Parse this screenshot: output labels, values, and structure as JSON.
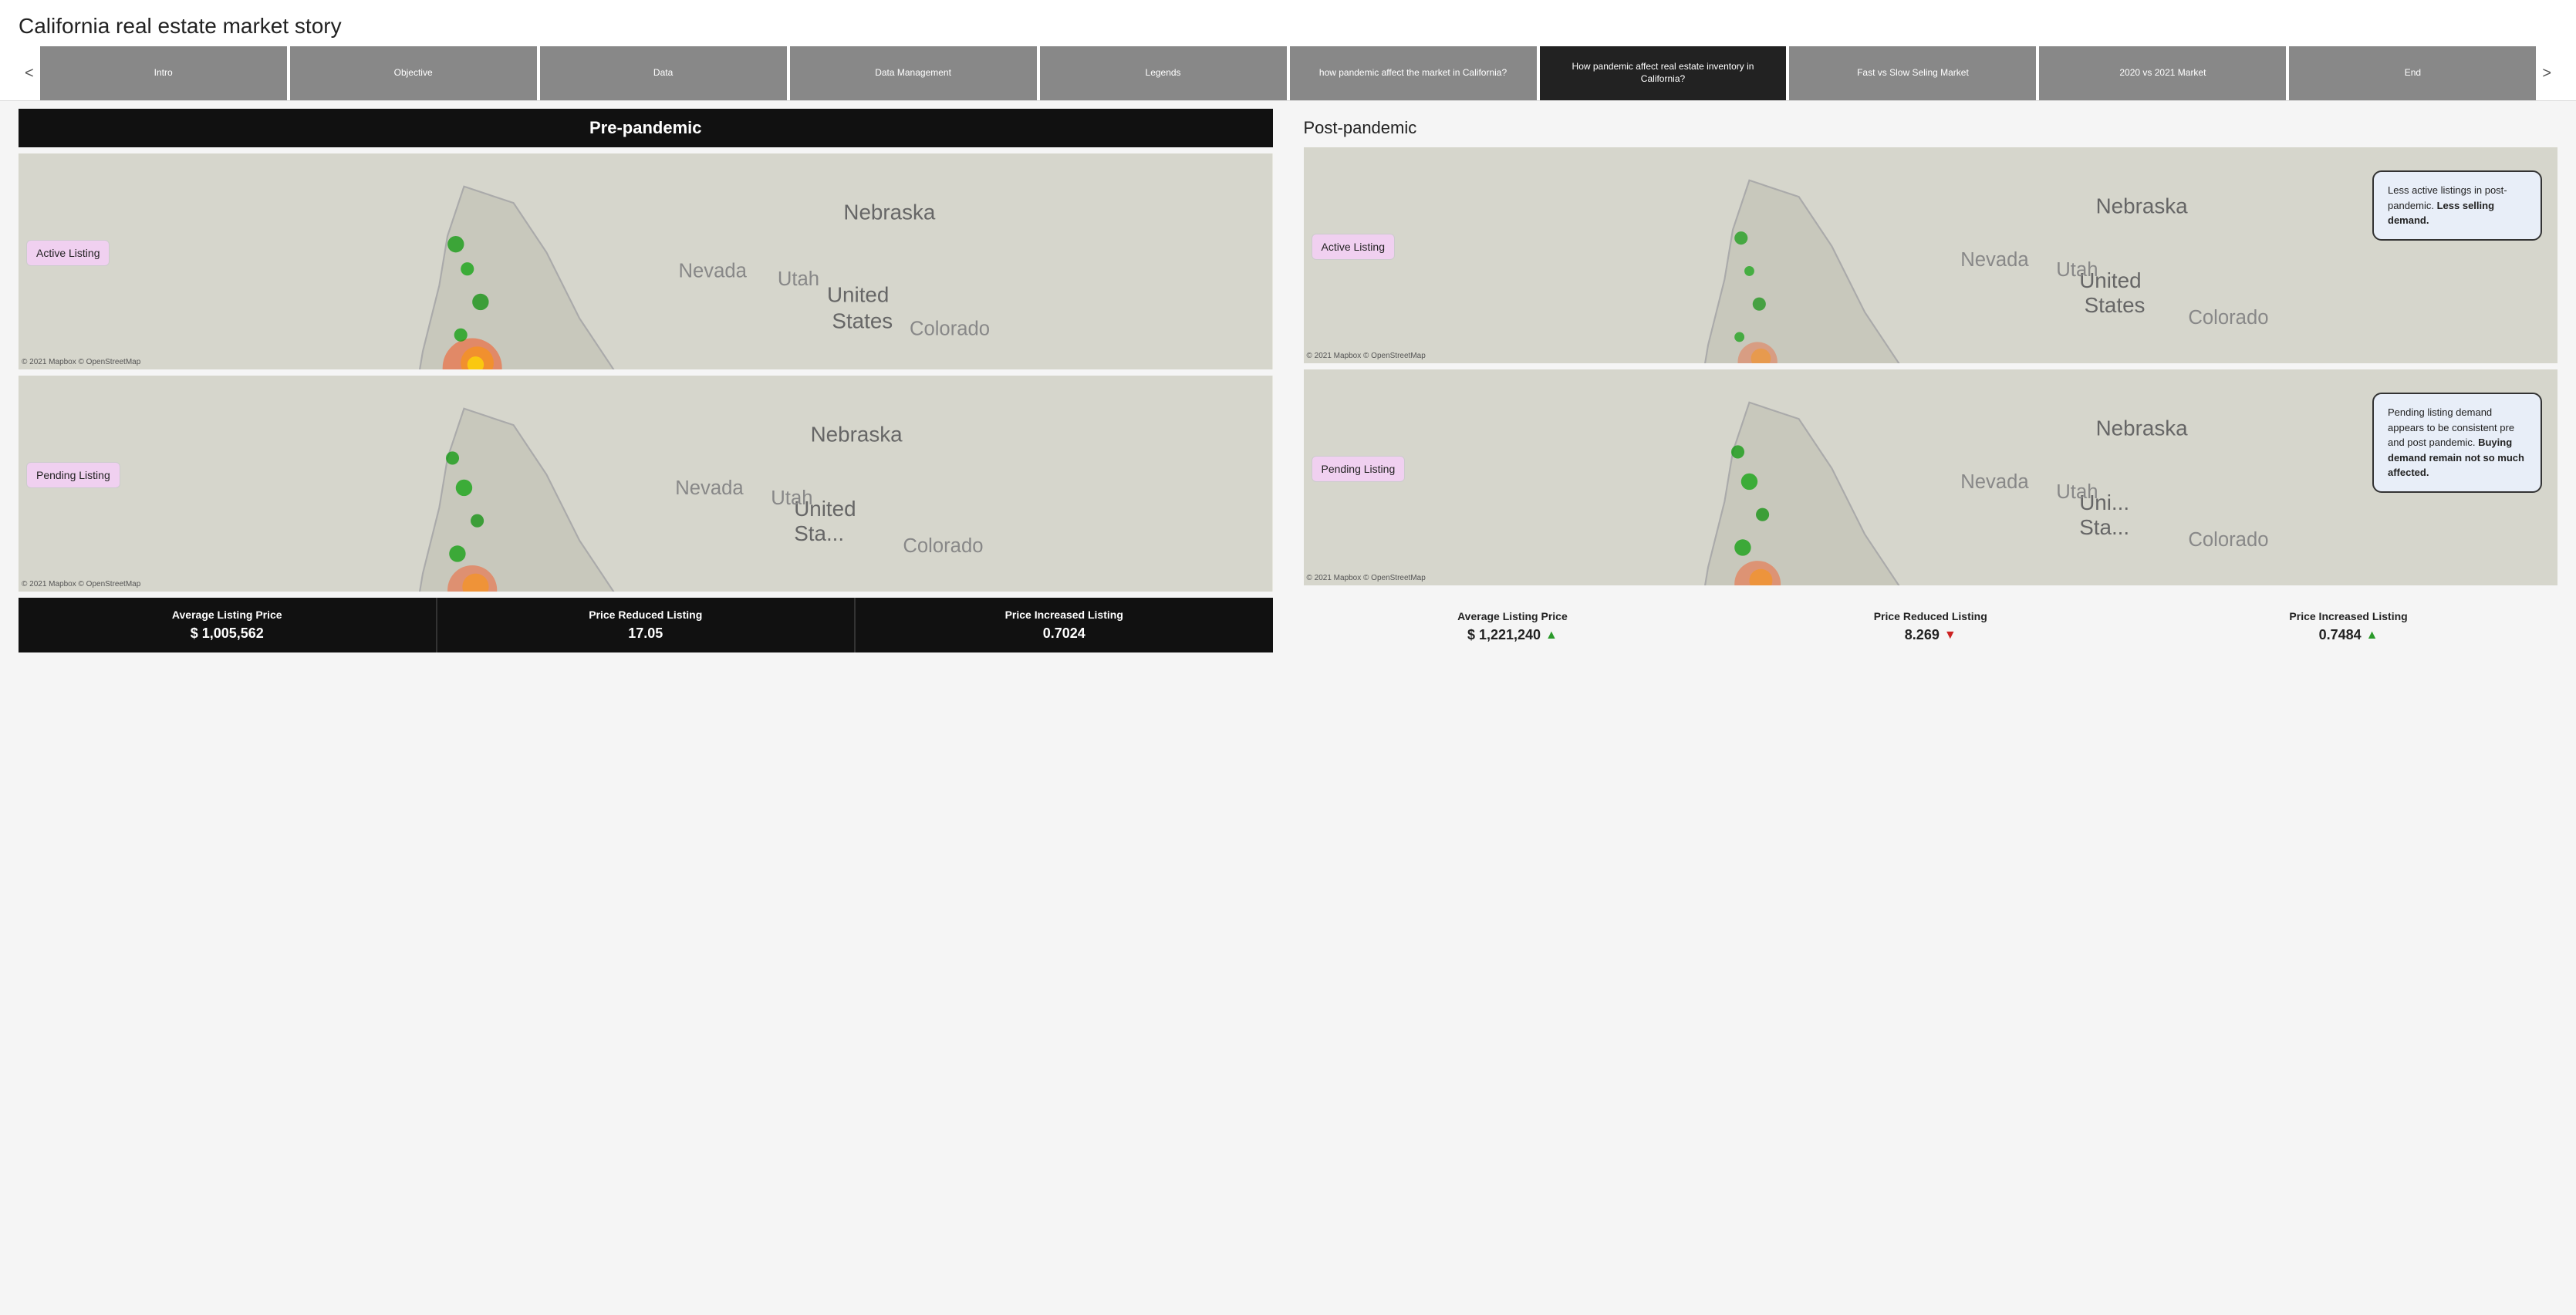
{
  "page": {
    "title": "California real estate market story"
  },
  "nav": {
    "prev_label": "<",
    "next_label": ">",
    "tabs": [
      {
        "id": "intro",
        "label": "Intro",
        "active": false
      },
      {
        "id": "objective",
        "label": "Objective",
        "active": false
      },
      {
        "id": "data",
        "label": "Data",
        "active": false
      },
      {
        "id": "data-management",
        "label": "Data Management",
        "active": false
      },
      {
        "id": "legends",
        "label": "Legends",
        "active": false
      },
      {
        "id": "how-pandemic-affect",
        "label": "how pandemic affect the market in California?",
        "active": false
      },
      {
        "id": "how-pandemic-inventory",
        "label": "How pandemic affect real estate inventory in California?",
        "active": true
      },
      {
        "id": "fast-vs-slow",
        "label": "Fast vs Slow Seling Market",
        "active": false
      },
      {
        "id": "2020-vs-2021",
        "label": "2020 vs 2021 Market",
        "active": false
      },
      {
        "id": "end",
        "label": "End",
        "active": false
      }
    ]
  },
  "pre_pandemic": {
    "title": "Pre-pandemic",
    "active_label": "Active Listing",
    "pending_label": "Pending Listing",
    "map_credit": "© 2021 Mapbox © OpenStreetMap",
    "map_credit2": "© 2021 Mapbox © OpenStreetMap",
    "stats": [
      {
        "label": "Average Listing Price",
        "value": "$ 1,005,562"
      },
      {
        "label": "Price Reduced Listing",
        "value": "17.05"
      },
      {
        "label": "Price Increased Listing",
        "value": "0.7024"
      }
    ]
  },
  "post_pandemic": {
    "title": "Post-pandemic",
    "active_label": "Active Listing",
    "pending_label": "Pending Listing",
    "map_credit": "© 2021 Mapbox © OpenStreetMap",
    "map_credit2": "© 2021 Mapbox © OpenStreetMap",
    "active_annotation": "Less active listings in post-pandemic. Less selling demand.",
    "pending_annotation_prefix": "Pending listing demand appears to be consistent pre and post pandemic. ",
    "pending_annotation_bold": "Buying demand remain not so much affected.",
    "stats": [
      {
        "label": "Average Listing Price",
        "value": "$ 1,221,240",
        "trend": "up"
      },
      {
        "label": "Price Reduced Listing",
        "value": "8.269",
        "trend": "down"
      },
      {
        "label": "Price Increased Listing",
        "value": "0.7484",
        "trend": "up"
      }
    ]
  },
  "icons": {
    "arrow_up": "▲",
    "arrow_down": "▼"
  }
}
